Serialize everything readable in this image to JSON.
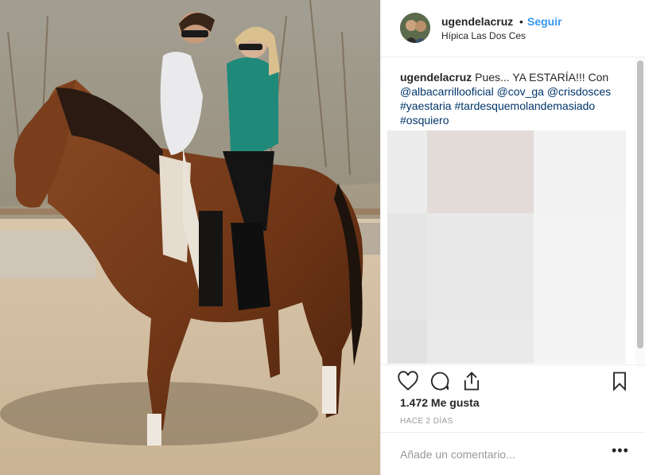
{
  "header": {
    "username": "ugendelacruz",
    "separator": "•",
    "follow_label": "Seguir",
    "location": "Hípica Las Dos Ces"
  },
  "caption": {
    "username": "ugendelacruz",
    "text": "Pues... YA ESTARÍA!!! Con",
    "mention1": "@albacarrillooficial",
    "mention2": "@cov_ga",
    "mention3": "@crisdosces",
    "hashtag1": "#yaestaria",
    "hashtag2": "#tardesquemolandemasiado",
    "hashtag3": "#osquiero"
  },
  "icons": {
    "like": "heart-icon",
    "comment": "comment-bubble-icon",
    "share": "share-icon",
    "save": "bookmark-icon",
    "more": "more-options-icon"
  },
  "stats": {
    "likes": "1.472 Me gusta",
    "time": "HACE 2 DÍAS"
  },
  "comment": {
    "placeholder": "Añade un comentario...",
    "more_label": "•••"
  },
  "colors": {
    "link": "#003569",
    "follow": "#3897f0",
    "muted": "#999999"
  }
}
